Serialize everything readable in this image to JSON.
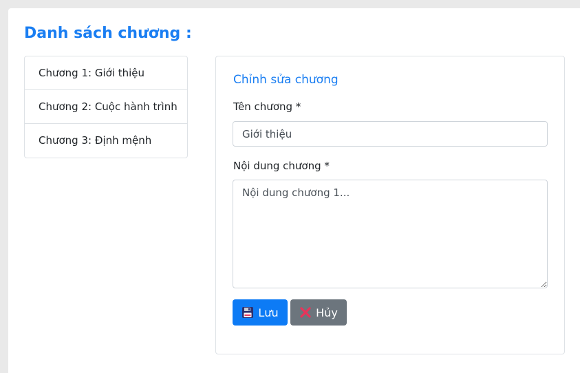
{
  "page": {
    "title": "Danh sách chương :"
  },
  "chapters": [
    {
      "label": "Chương 1: Giới thiệu"
    },
    {
      "label": "Chương 2: Cuộc hành trình"
    },
    {
      "label": "Chương 3: Định mệnh"
    }
  ],
  "editor": {
    "heading": "Chỉnh sửa chương",
    "title_label": "Tên chương *",
    "title_value": "Giới thiệu",
    "content_label": "Nội dung chương *",
    "content_value": "Nội dung chương 1...",
    "save_label": "Lưu",
    "save_icon": "floppy-disk-icon",
    "cancel_label": "Hủy",
    "cancel_icon": "cross-mark-icon"
  },
  "colors": {
    "accent": "#1a7ef2",
    "primary_button": "#0d7bf5",
    "secondary_button": "#6c757d",
    "cancel_icon": "#e8345a"
  }
}
